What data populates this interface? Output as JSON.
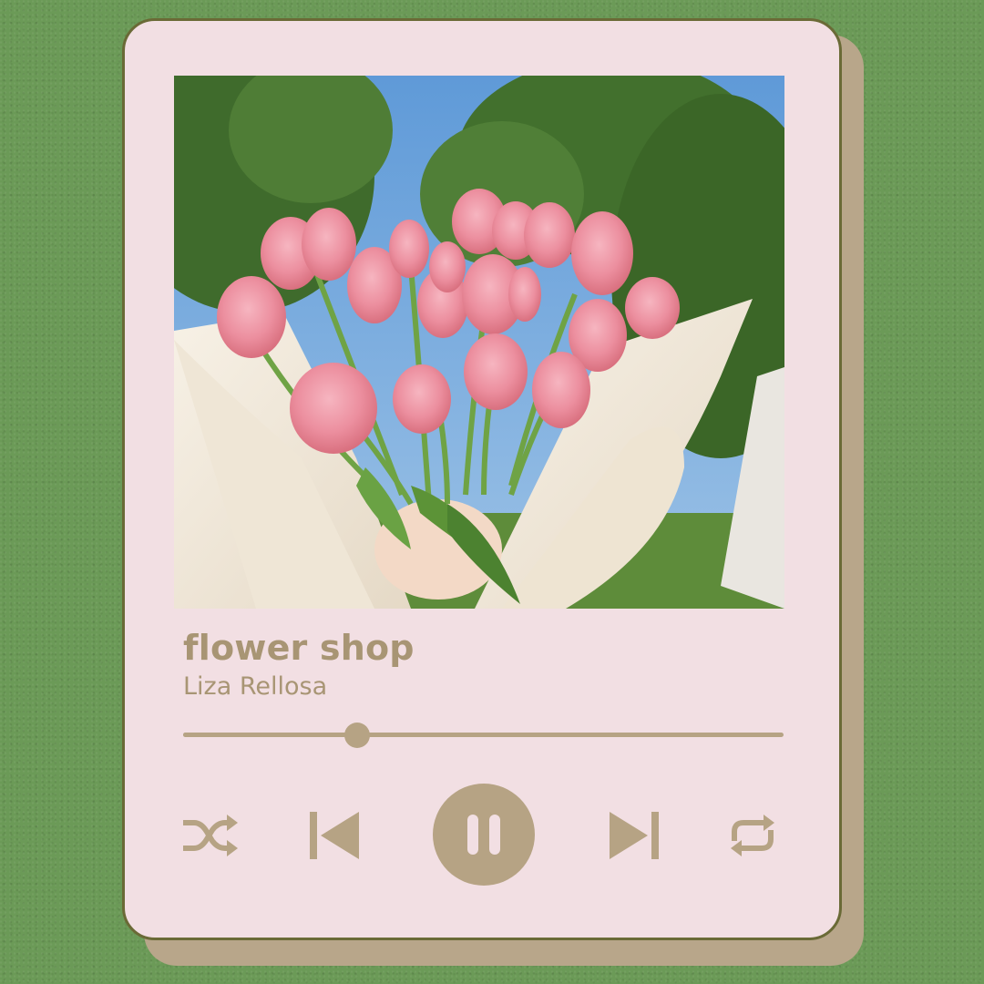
{
  "song": {
    "title": "flower shop",
    "artist": "Liza Rellosa"
  },
  "progress": 0.29,
  "controls": {
    "shuffle_icon": "shuffle-icon",
    "previous_icon": "skip-previous-icon",
    "play_pause_icon": "pause-icon",
    "next_icon": "skip-next-icon",
    "repeat_icon": "repeat-icon"
  },
  "colors": {
    "background": "#6b9a57",
    "card": "#f2dfe3",
    "accent": "#b6a384",
    "card_border": "#6a6a36"
  }
}
